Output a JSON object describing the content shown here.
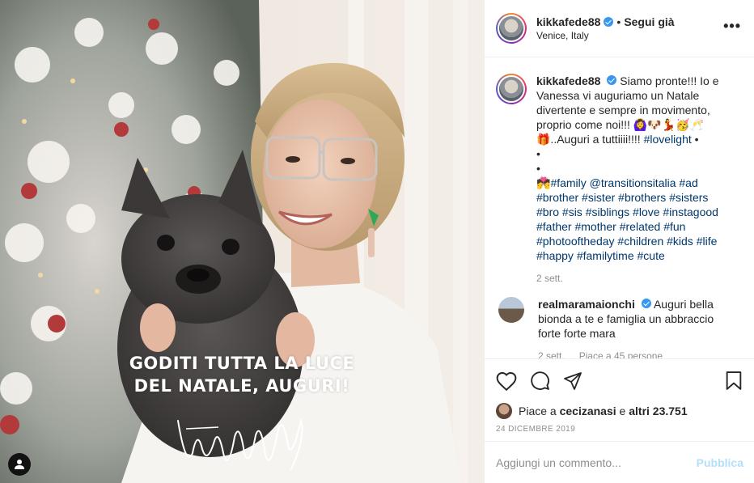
{
  "post": {
    "overlay_line_1": "GODITI TUTTA LA LUCE",
    "overlay_line_2": "DEL NATALE, AUGURI!",
    "signature": "FedericaPellegrini"
  },
  "header": {
    "username": "kikkafede88",
    "dot": "•",
    "follow_label": "Segui già",
    "location": "Venice, Italy",
    "more_label": "•••"
  },
  "caption": {
    "username": "kikkafede88",
    "text_1": "Siamo pronte!!! Io e Vanessa vi auguriamo un Natale divertente e sempre in movimento, proprio come noi!!! 🙆‍♀️🐶💃🥳🥂",
    "text_2": "🎁..Auguri a tuttiiii!!!! ",
    "hashtag_lovelight": "#lovelight",
    "bullet_1": " •",
    "bullet_2": "•",
    "bullet_3": "•",
    "text_3_prefix": "💏",
    "tags": "#family @transitionsitalia #ad #brother #sister #brothers #sisters #bro #sis #siblings #love #instagood #father #mother #related #fun #photooftheday #children #kids #life #happy #familytime #cute",
    "time": "2 sett."
  },
  "comment": {
    "username": "realmaramaionchi",
    "text": "Auguri bella bionda a te e famiglia un abbraccio forte forte mara",
    "time": "2 sett.",
    "likes": "Piace a 45 persone"
  },
  "likes": {
    "prefix": "Piace a ",
    "user": "cecizanasi",
    "middle": " e ",
    "others": "altri 23.751"
  },
  "date": "24 DICEMBRE 2019",
  "add_comment": {
    "placeholder": "Aggiungi un commento...",
    "publish_label": "Pubblica"
  },
  "colors": {
    "link": "#00376b",
    "verified": "#3897f0",
    "muted": "#8e8e8e",
    "publish_disabled": "#b2dffc"
  }
}
